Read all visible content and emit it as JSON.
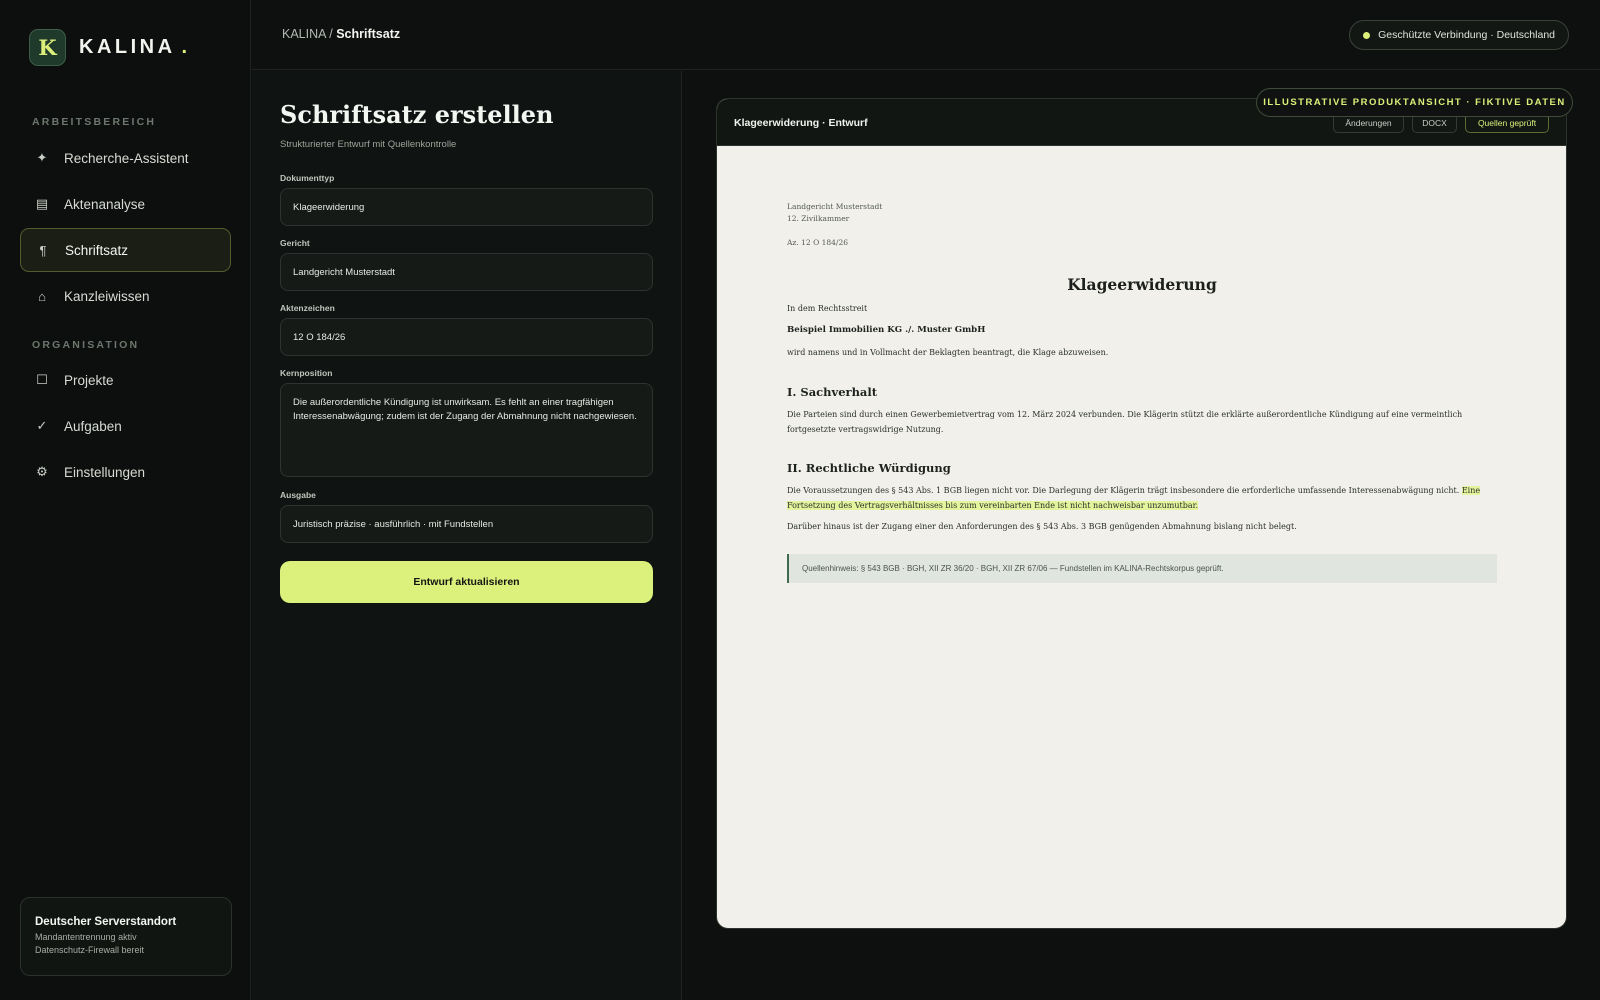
{
  "brand": {
    "logo_letter": "K",
    "name": "KALINA",
    "dot": "."
  },
  "sidebar": {
    "section_workspace": "ARBEITSBEREICH",
    "section_org": "ORGANISATION",
    "items": [
      {
        "label": "Recherche-Assistent",
        "icon": "sparkle-icon",
        "glyph": "✦"
      },
      {
        "label": "Aktenanalyse",
        "icon": "document-list-icon",
        "glyph": "▤"
      },
      {
        "label": "Schriftsatz",
        "icon": "pilcrow-icon",
        "glyph": "¶"
      },
      {
        "label": "Kanzleiwissen",
        "icon": "home-icon",
        "glyph": "⌂"
      },
      {
        "label": "Projekte",
        "icon": "square-icon",
        "glyph": "☐"
      },
      {
        "label": "Aufgaben",
        "icon": "check-icon",
        "glyph": "✓"
      },
      {
        "label": "Einstellungen",
        "icon": "gear-icon",
        "glyph": "⚙"
      }
    ],
    "active_item": "Schriftsatz",
    "server_card": {
      "title": "Deutscher Serverstandort",
      "line1": "Mandantentrennung aktiv",
      "line2": "Datenschutz-Firewall bereit"
    }
  },
  "topbar": {
    "breadcrumb_root": "KALINA",
    "breadcrumb_sep": " / ",
    "breadcrumb_current": "Schriftsatz",
    "connection": "Geschützte Verbindung · Deutschland"
  },
  "form": {
    "title": "Schriftsatz erstellen",
    "subtitle": "Strukturierter Entwurf mit Quellenkontrolle",
    "fields": {
      "doctype": {
        "label": "Dokumenttyp",
        "value": "Klageerwiderung"
      },
      "court": {
        "label": "Gericht",
        "value": "Landgericht Musterstadt"
      },
      "file_number": {
        "label": "Aktenzeichen",
        "value": "12 O 184/26"
      },
      "core_position": {
        "label": "Kernposition",
        "value": "Die außerordentliche Kündigung ist unwirksam. Es fehlt an einer tragfähigen Interessenabwägung; zudem ist der Zugang der Abmahnung nicht nachgewiesen."
      },
      "output": {
        "label": "Ausgabe",
        "value": "Juristisch präzise · ausführlich · mit Fundstellen"
      }
    },
    "cta": "Entwurf aktualisieren"
  },
  "preview": {
    "badge": "ILLUSTRATIVE PRODUKTANSICHT · FIKTIVE DATEN",
    "header_title": "Klageerwiderung · Entwurf",
    "buttons": {
      "changes": "Änderungen",
      "docx": "DOCX",
      "sources": "Quellen geprüft"
    },
    "doc": {
      "court": "Landgericht Musterstadt",
      "chamber": "12. Zivilkammer",
      "file_ref": "Az. 12 O 184/26",
      "title": "Klageerwiderung",
      "intro": "In dem Rechtsstreit",
      "parties": "Beispiel Immobilien KG ./. Muster GmbH",
      "motion": "wird namens und in Vollmacht der Beklagten beantragt, die Klage abzuweisen.",
      "section1_heading": "I. Sachverhalt",
      "section1_text": "Die Parteien sind durch einen Gewerbemietvertrag vom 12. März 2024 verbunden. Die Klägerin stützt die erklärte außerordentliche Kündigung auf eine vermeintlich fortgesetzte vertragswidrige Nutzung.",
      "section2_heading": "II. Rechtliche Würdigung",
      "section2_text": "Die Voraussetzungen des § 543 Abs. 1 BGB liegen nicht vor. Die Darlegung der Klägerin trägt insbesondere die erforderliche umfassende Interessenabwägung nicht.",
      "section2_highlight": "Eine Fortsetzung des Vertragsverhältnisses bis zum vereinbarten Ende ist nicht nachweisbar unzumutbar.",
      "section2_text2": "Darüber hinaus ist der Zugang einer den Anforderungen des § 543 Abs. 3 BGB genügenden Abmahnung bislang nicht belegt.",
      "source_note": "Quellenhinweis: § 543 BGB · BGH, XII ZR 36/20 · BGH, XII ZR 67/06 — Fundstellen im KALINA-Rechtskorpus geprüft."
    }
  }
}
